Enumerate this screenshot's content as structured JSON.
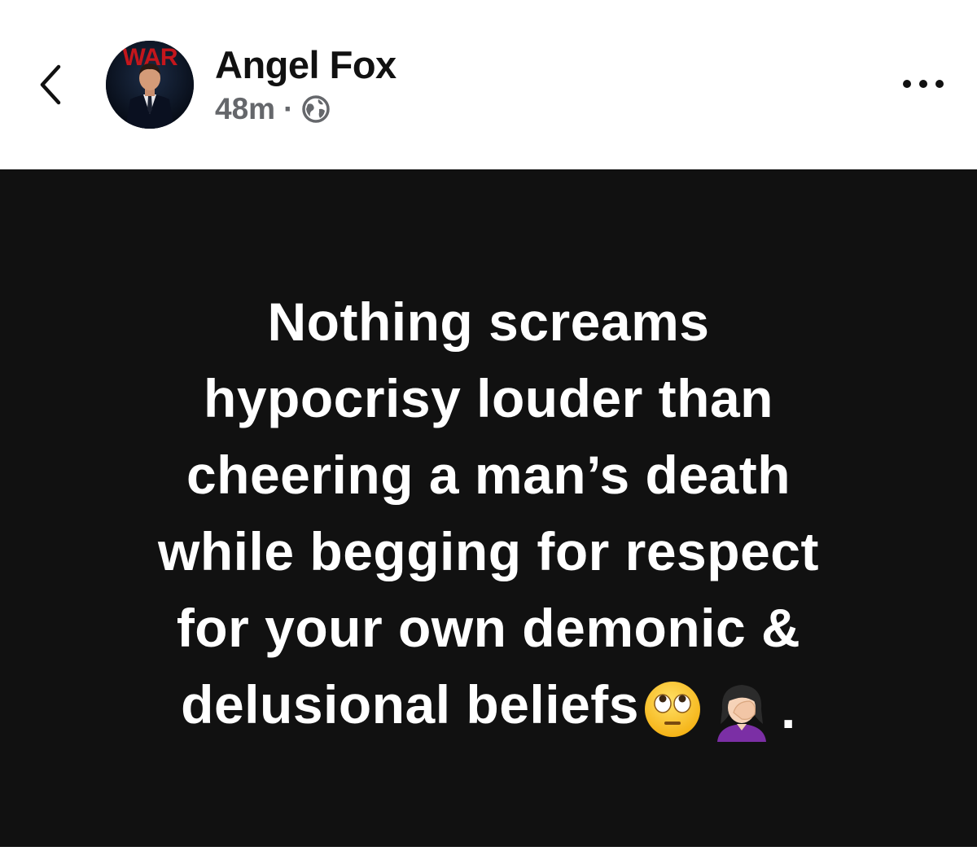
{
  "header": {
    "author_name": "Angel Fox",
    "timestamp": "48m",
    "separator": "·",
    "privacy_icon": "globe-icon",
    "back_icon": "chevron-left-icon",
    "more_icon": "more-dots-icon",
    "avatar_overlay_text": "WAR"
  },
  "post": {
    "background_color": "#111111",
    "text_color": "#ffffff",
    "lines": [
      "Nothing screams",
      "hypocrisy louder than",
      "cheering a man’s death",
      "while begging for respect",
      "for your own demonic &",
      "delusional beliefs"
    ],
    "emojis": [
      "face-with-rolling-eyes-icon",
      "woman-facepalming-icon"
    ],
    "trailing_punctuation": "."
  }
}
